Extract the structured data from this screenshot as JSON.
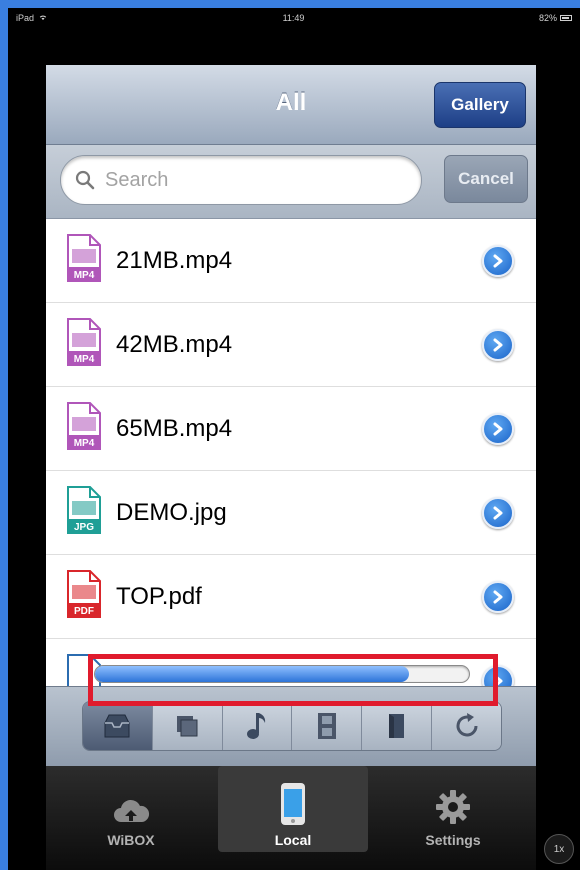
{
  "status_bar": {
    "carrier": "iPad",
    "time": "11:49",
    "battery": "82%"
  },
  "navbar": {
    "title": "All",
    "gallery_label": "Gallery"
  },
  "search": {
    "placeholder": "Search",
    "cancel_label": "Cancel"
  },
  "files": [
    {
      "name": "21MB.mp4",
      "type": "MP4",
      "color": "#b056b9"
    },
    {
      "name": "42MB.mp4",
      "type": "MP4",
      "color": "#b056b9"
    },
    {
      "name": "65MB.mp4",
      "type": "MP4",
      "color": "#b056b9"
    },
    {
      "name": "DEMO.jpg",
      "type": "JPG",
      "color": "#1f9f96"
    },
    {
      "name": "TOP.pdf",
      "type": "PDF",
      "color": "#d9262b"
    }
  ],
  "transfer": {
    "progress": 0.84
  },
  "toolbar": {
    "filters": [
      "inbox-icon",
      "photos-icon",
      "music-icon",
      "video-icon",
      "document-icon",
      "refresh-icon"
    ],
    "active_filter": "inbox-icon"
  },
  "tabbar": {
    "tabs": [
      {
        "label": "WiBOX",
        "icon": "cloud-icon"
      },
      {
        "label": "Local",
        "icon": "iphone-icon"
      },
      {
        "label": "Settings",
        "icon": "gear-icon"
      }
    ],
    "active": "Local"
  },
  "zoom_badge": "1x",
  "colors": {
    "accent": "#1d3f86",
    "highlight": "#e01b2d"
  }
}
